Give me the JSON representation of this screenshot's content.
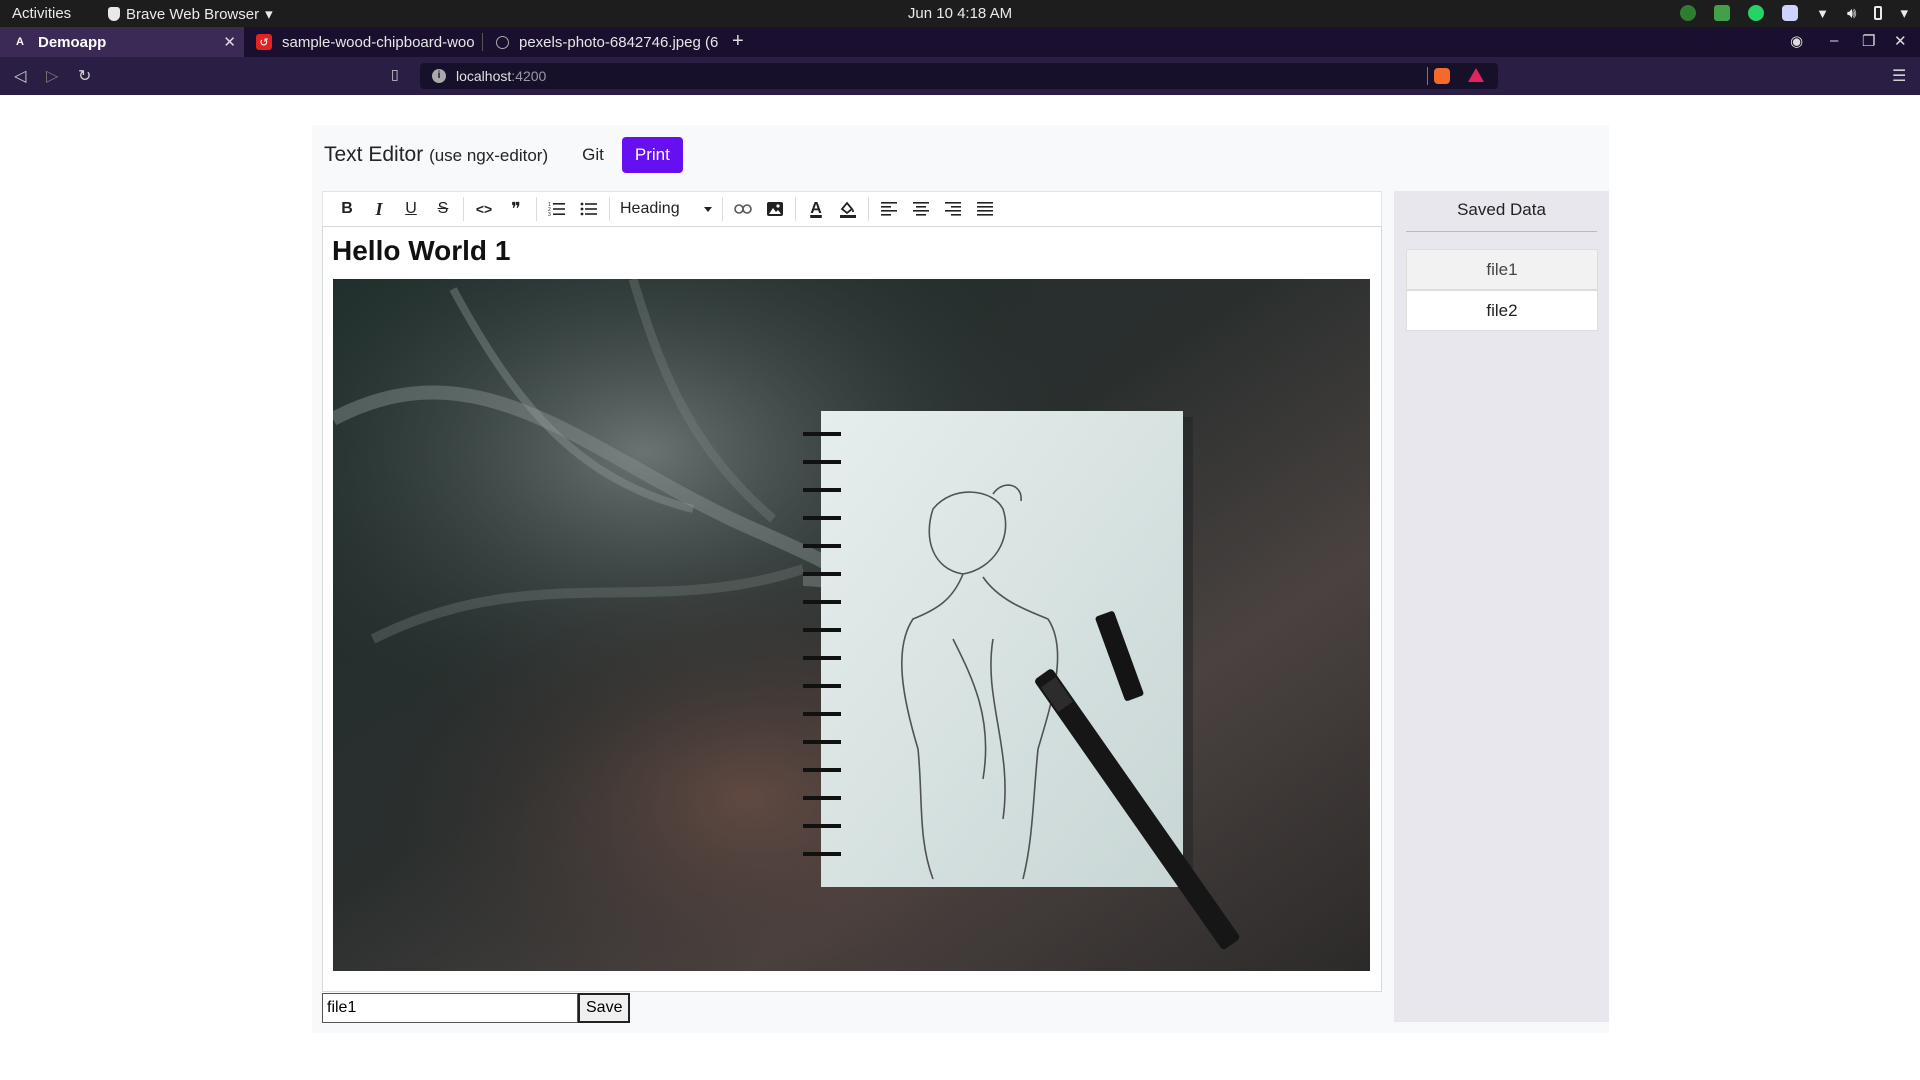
{
  "system": {
    "activities": "Activities",
    "app_name": "Brave Web Browser",
    "datetime": "Jun 10  4:18 AM"
  },
  "tabs": [
    {
      "label": "Demoapp",
      "favicon": "angular-icon",
      "active": true
    },
    {
      "label": "sample-wood-chipboard-woo",
      "favicon": "red-app-icon",
      "active": false
    },
    {
      "label": "pexels-photo-6842746.jpeg (6",
      "favicon": "globe-icon",
      "active": false
    }
  ],
  "address": {
    "host": "localhost",
    "port": ":4200"
  },
  "page": {
    "title": "Text Editor",
    "subtitle": "(use ngx-editor)",
    "git_label": "Git",
    "print_label": "Print"
  },
  "toolbar": {
    "bold": "B",
    "italic": "I",
    "underline": "U",
    "strike": "S",
    "code": "<>",
    "quote": "❞",
    "heading_value": "Heading"
  },
  "editor": {
    "heading": "Hello World 1"
  },
  "save": {
    "filename": "file1",
    "button_label": "Save"
  },
  "saved_panel": {
    "title": "Saved Data",
    "files": [
      "file1",
      "file2"
    ]
  },
  "colors": {
    "print_button": "#6610f2",
    "tab_strip": "#1a0f2e",
    "panel_bg": "#e8e7ee"
  }
}
